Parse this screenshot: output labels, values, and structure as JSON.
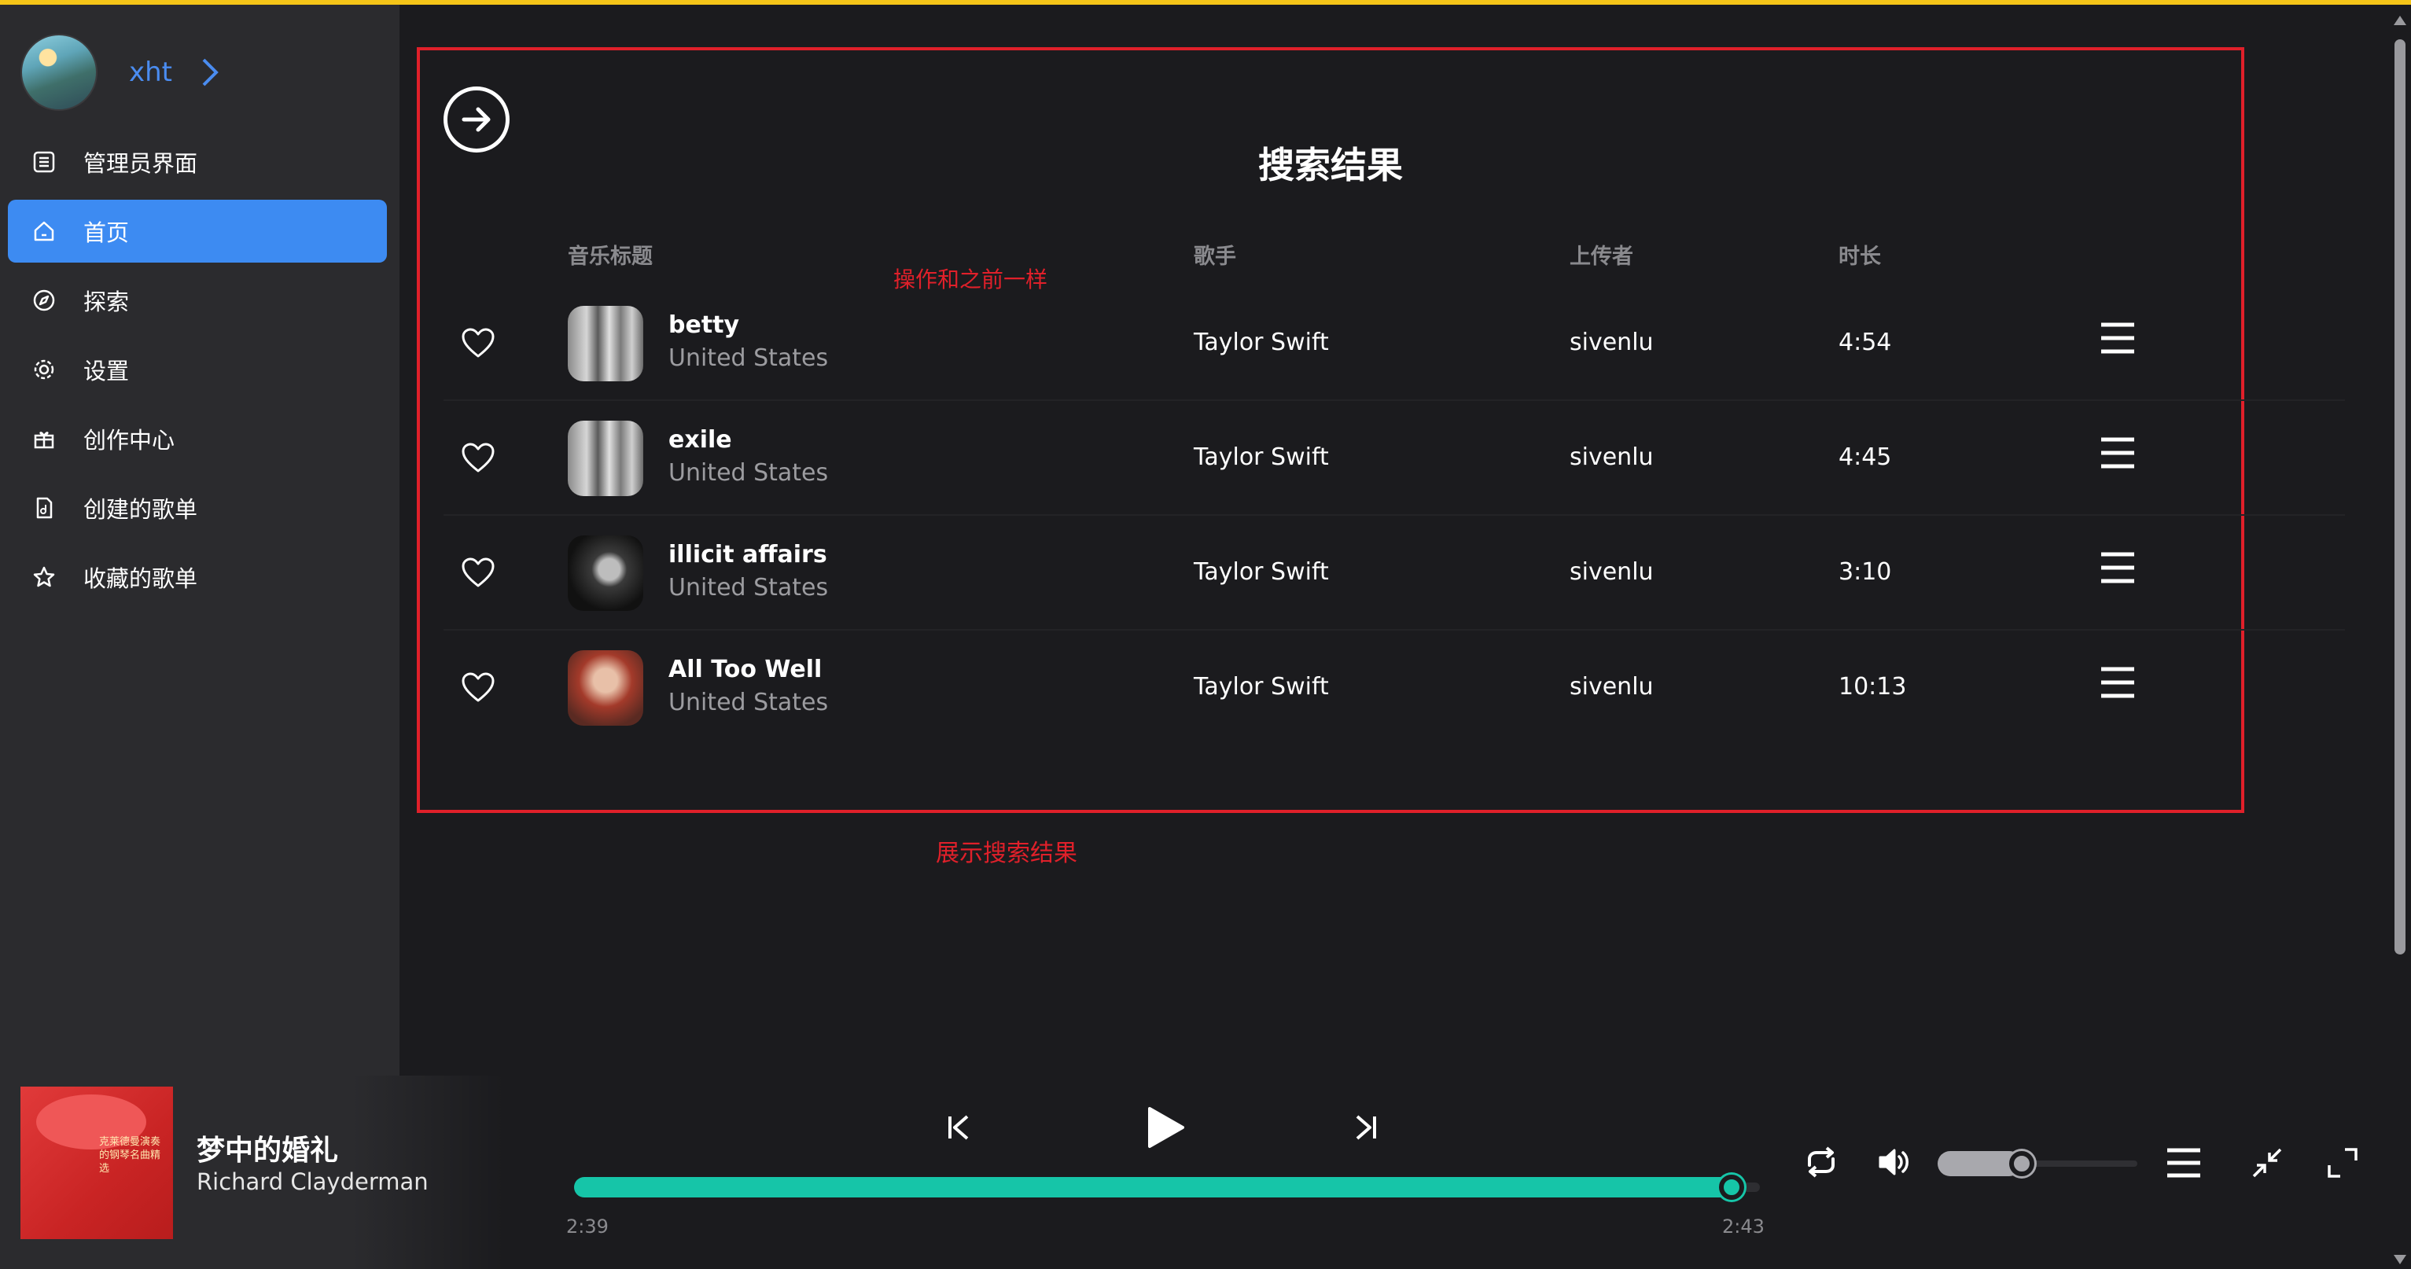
{
  "user": {
    "name": "xht"
  },
  "sidebar": {
    "items": [
      {
        "label": "管理员界面",
        "icon": "list-icon",
        "active": false
      },
      {
        "label": "首页",
        "icon": "home-icon",
        "active": true
      },
      {
        "label": "探索",
        "icon": "compass-icon",
        "active": false
      },
      {
        "label": "设置",
        "icon": "gear-icon",
        "active": false
      },
      {
        "label": "创作中心",
        "icon": "gift-icon",
        "active": false
      },
      {
        "label": "创建的歌单",
        "icon": "document-icon",
        "active": false
      },
      {
        "label": "收藏的歌单",
        "icon": "star-icon",
        "active": false
      }
    ]
  },
  "results": {
    "title": "搜索结果",
    "columns": {
      "title": "音乐标题",
      "artist": "歌手",
      "uploader": "上传者",
      "duration": "时长"
    },
    "note_ops": "操作和之前一样",
    "note_show": "展示搜索结果",
    "songs": [
      {
        "title": "betty",
        "region": "United States",
        "artist": "Taylor Swift",
        "uploader": "sivenlu",
        "duration": "4:54"
      },
      {
        "title": "exile",
        "region": "United States",
        "artist": "Taylor Swift",
        "uploader": "sivenlu",
        "duration": "4:45"
      },
      {
        "title": "illicit affairs",
        "region": "United States",
        "artist": "Taylor Swift",
        "uploader": "sivenlu",
        "duration": "3:10"
      },
      {
        "title": "All Too Well",
        "region": "United States",
        "artist": "Taylor Swift",
        "uploader": "sivenlu",
        "duration": "10:13"
      }
    ]
  },
  "player": {
    "title": "梦中的婚礼",
    "artist": "Richard Clayderman",
    "cover_text": "克莱德曼演奏的钢琴名曲精选",
    "elapsed": "2:39",
    "total": "2:43",
    "progress": 0.976,
    "volume": 0.42
  },
  "colors": {
    "accent": "#3d8bf2",
    "progress": "#16c5a8",
    "annotation": "#e0202a",
    "topline": "#f5c518"
  }
}
